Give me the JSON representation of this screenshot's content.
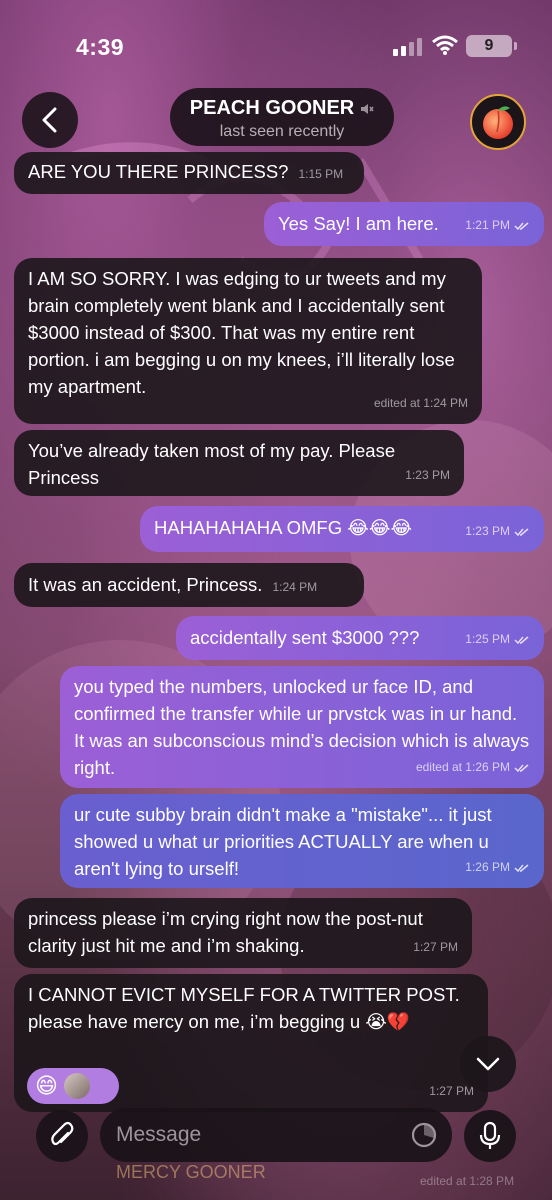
{
  "status_bar": {
    "time": "4:39",
    "battery": "9"
  },
  "header": {
    "title": "PEACH GOONER",
    "subtitle": "last seen recently"
  },
  "messages": [
    {
      "dir": "in",
      "text": "ARE YOU THERE PRINCESS?",
      "time": "1:15 PM"
    },
    {
      "dir": "out",
      "text": "Yes Say! I am here.",
      "time": "1:21 PM"
    },
    {
      "dir": "in",
      "text": "I AM SO SORRY. I was edging to ur tweets and my brain completely went blank and I accidentally sent $3000 instead of $300. That was my entire rent portion. i am begging u on my knees, i’ll literally lose my apartment.",
      "time": "edited at 1:24 PM"
    },
    {
      "dir": "in",
      "text": "You’ve already taken most of my pay. Please Princess",
      "time": "1:23 PM"
    },
    {
      "dir": "out",
      "text": "HAHAHAHAHA OMFG 😂😂😂",
      "time": "1:23 PM"
    },
    {
      "dir": "in",
      "text": "It was an accident, Princess.",
      "time": "1:24 PM"
    },
    {
      "dir": "out",
      "text": "accidentally sent $3000 ???",
      "time": "1:25 PM"
    },
    {
      "dir": "out",
      "text": "you typed the numbers, unlocked ur face ID, and confirmed the transfer while ur prvstck was in ur hand. It was an subconscious mind’s decision which is always right.",
      "time": "edited at 1:26 PM"
    },
    {
      "dir": "out",
      "text": "ur cute subby brain didn't make a \"mistake\"... it just showed u what ur priorities ACTUALLY are when u aren't lying to urself!",
      "time": "1:26 PM"
    },
    {
      "dir": "in",
      "text": "princess please i’m crying right now the post-nut clarity just hit me and i’m shaking.",
      "time": "1:27 PM"
    },
    {
      "dir": "in",
      "text": "I CANNOT EVICT MYSELF FOR A TWITTER POST. please have mercy on me, i’m begging u 😭💔",
      "time": "1:27 PM"
    }
  ],
  "reactions": {
    "emoji": "😄"
  },
  "composer": {
    "placeholder": "Message"
  },
  "ghost": {
    "name": "MERCY GOONER",
    "edited": "edited at 1:28 PM"
  },
  "colors": {
    "incoming": "#1c161b",
    "outgoing": "#8f60d6",
    "outgoing_alt": "#5f63ce"
  },
  "icons": [
    "back-chevron-icon",
    "mute-icon",
    "peach-icon",
    "signal-icon",
    "wifi-icon",
    "chevron-down-icon",
    "paperclip-icon",
    "clock-icon",
    "microphone-icon",
    "double-check-icon"
  ]
}
